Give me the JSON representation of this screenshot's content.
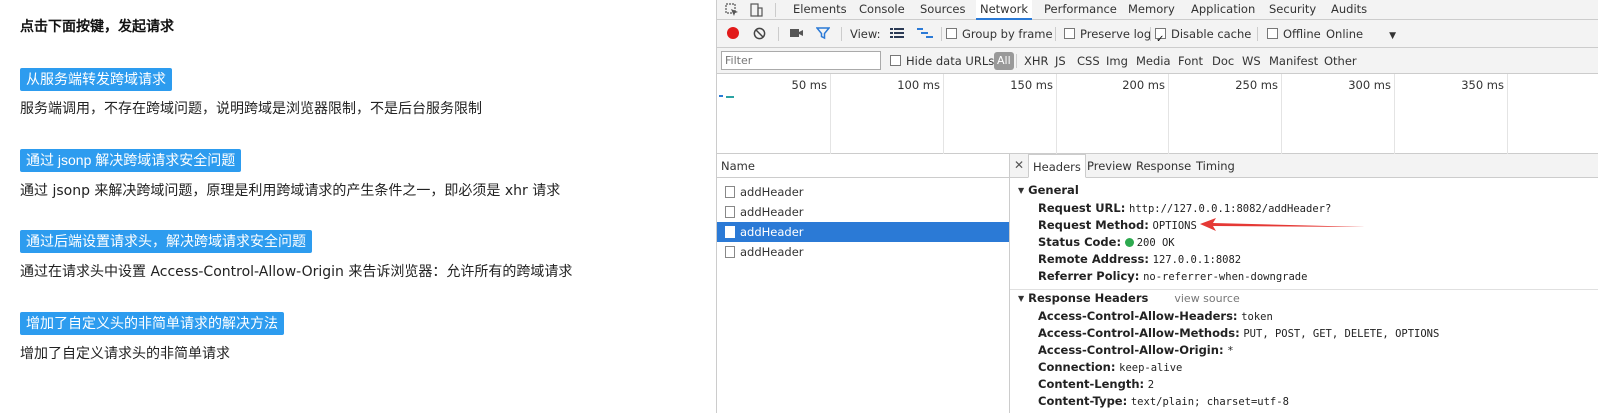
{
  "page": {
    "title": "点击下面按键，发起请求",
    "sections": [
      {
        "button": "从服务端转发跨域请求",
        "desc": "服务端调用，不存在跨域问题，说明跨域是浏览器限制，不是后台服务限制"
      },
      {
        "button": "通过 jsonp 解决跨域请求安全问题",
        "desc": "通过 jsonp 来解决跨域问题，原理是利用跨域请求的产生条件之一，即必须是 xhr 请求"
      },
      {
        "button": "通过后端设置请求头，解决跨域请求安全问题",
        "desc": "通过在请求头中设置 Access-Control-Allow-Origin 来告诉浏览器：允许所有的跨域请求"
      },
      {
        "button": "增加了自定义头的非简单请求的解决方法",
        "desc": "增加了自定义请求头的非简单请求"
      }
    ]
  },
  "devtools": {
    "tabs": [
      "Elements",
      "Console",
      "Sources",
      "Network",
      "Performance",
      "Memory",
      "Application",
      "Security",
      "Audits"
    ],
    "active_tab": "Network",
    "toolbar": {
      "view_label": "View:",
      "group_by_frame": "Group by frame",
      "preserve_log": "Preserve log",
      "disable_cache": "Disable cache",
      "offline": "Offline",
      "throttle": "Online",
      "disable_cache_checked": true,
      "preserve_log_checked": false,
      "offline_checked": false,
      "group_by_frame_checked": false
    },
    "filter": {
      "placeholder": "Filter",
      "hide_data_urls": "Hide data URLs",
      "types": [
        "All",
        "XHR",
        "JS",
        "CSS",
        "Img",
        "Media",
        "Font",
        "Doc",
        "WS",
        "Manifest",
        "Other"
      ]
    },
    "timeline_ticks": [
      "50 ms",
      "100 ms",
      "150 ms",
      "200 ms",
      "250 ms",
      "300 ms",
      "350 ms"
    ],
    "name_header": "Name",
    "requests": [
      {
        "name": "addHeader"
      },
      {
        "name": "addHeader"
      },
      {
        "name": "addHeader"
      },
      {
        "name": "addHeader"
      }
    ],
    "selected_request_index": 2,
    "detail_tabs": [
      "Headers",
      "Preview",
      "Response",
      "Timing"
    ],
    "general": {
      "title": "General",
      "request_url_k": "Request URL:",
      "request_url_v": "http://127.0.0.1:8082/addHeader?",
      "request_method_k": "Request Method:",
      "request_method_v": "OPTIONS",
      "status_code_k": "Status Code:",
      "status_code_v": "200 OK",
      "remote_address_k": "Remote Address:",
      "remote_address_v": "127.0.0.1:8082",
      "referrer_policy_k": "Referrer Policy:",
      "referrer_policy_v": "no-referrer-when-downgrade"
    },
    "response_headers": {
      "title": "Response Headers",
      "view_source": "view source",
      "items": [
        {
          "k": "Access-Control-Allow-Headers:",
          "v": "token"
        },
        {
          "k": "Access-Control-Allow-Methods:",
          "v": "PUT, POST, GET, DELETE, OPTIONS"
        },
        {
          "k": "Access-Control-Allow-Origin:",
          "v": "*"
        },
        {
          "k": "Connection:",
          "v": "keep-alive"
        },
        {
          "k": "Content-Length:",
          "v": "2"
        },
        {
          "k": "Content-Type:",
          "v": "text/plain; charset=utf-8"
        }
      ]
    },
    "colors": {
      "accent": "#2b7ad6",
      "record": "#e21a1a",
      "annotation_arrow": "#e53935",
      "status_ok": "#2da94f",
      "page_button": "#2d9cef"
    }
  }
}
